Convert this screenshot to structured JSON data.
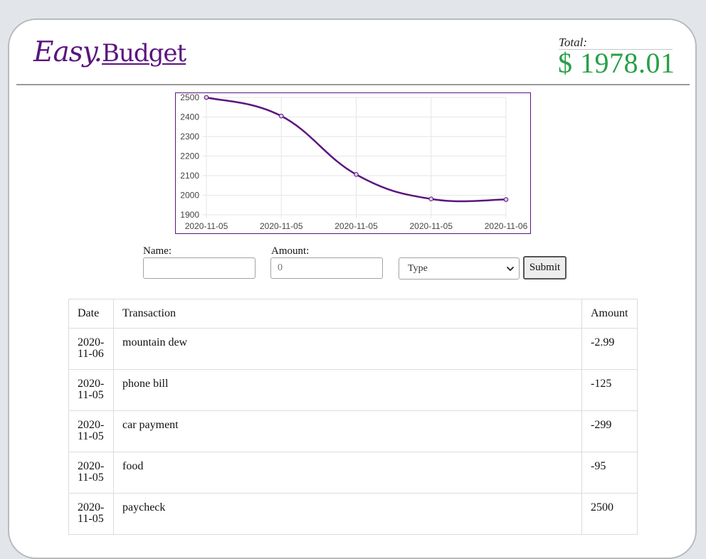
{
  "header": {
    "logo_part1": "Easy.",
    "logo_part2": "Budget",
    "total_label": "Total:",
    "total_value": "$ 1978.01"
  },
  "chart_data": {
    "type": "line",
    "x": [
      "2020-11-05",
      "2020-11-05",
      "2020-11-05",
      "2020-11-05",
      "2020-11-06"
    ],
    "y_ticks": [
      2500,
      2400,
      2300,
      2200,
      2100,
      2000,
      1900
    ],
    "ylim": [
      1900,
      2500
    ],
    "grid": true,
    "series": [
      {
        "values": [
          2500,
          2405,
          2106,
          1981,
          1978.01
        ],
        "color": "#5b157e"
      }
    ]
  },
  "form": {
    "name_label": "Name:",
    "name_value": "",
    "amount_label": "Amount:",
    "amount_placeholder": "0",
    "type_selected": "Type",
    "submit_label": "Submit"
  },
  "table": {
    "headers": [
      "Date",
      "Transaction",
      "Amount"
    ],
    "rows": [
      {
        "date": "2020-11-06",
        "name": "mountain dew",
        "amount": "-2.99"
      },
      {
        "date": "2020-11-05",
        "name": "phone bill",
        "amount": "-125"
      },
      {
        "date": "2020-11-05",
        "name": "car payment",
        "amount": "-299"
      },
      {
        "date": "2020-11-05",
        "name": "food",
        "amount": "-95"
      },
      {
        "date": "2020-11-05",
        "name": "paycheck",
        "amount": "2500"
      }
    ]
  }
}
